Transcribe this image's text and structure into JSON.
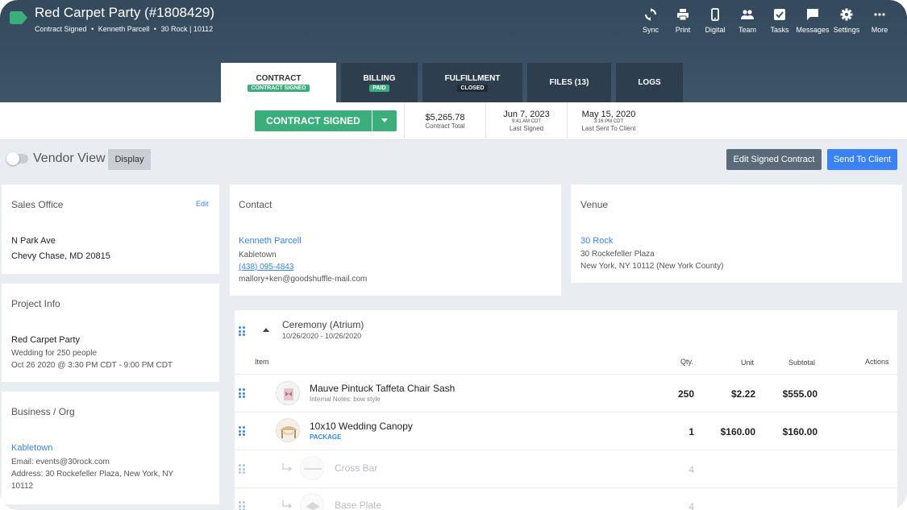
{
  "header": {
    "title": "Red Carpet Party (#1808429)",
    "status": "Contract Signed",
    "client": "Kenneth Parcell",
    "venue_short": "30 Rock | 10112",
    "dot": "•"
  },
  "toolbar": {
    "sync": "Sync",
    "print": "Print",
    "digital": "Digital",
    "team": "Team",
    "tasks": "Tasks",
    "messages": "Messages",
    "settings": "Settings",
    "more": "More"
  },
  "tabs": {
    "contract": {
      "label": "CONTRACT",
      "badge": "CONTRACT SIGNED"
    },
    "billing": {
      "label": "BILLING",
      "badge": "PAID"
    },
    "fulfillment": {
      "label": "FULFILLMENT",
      "badge": "CLOSED"
    },
    "files": {
      "label": "FILES (13)"
    },
    "logs": {
      "label": "LOGS"
    }
  },
  "statusbar": {
    "action_label": "CONTRACT SIGNED",
    "total_value": "$5,265.78",
    "total_label": "Contract Total",
    "signed_date": "Jun 7, 2023",
    "signed_time": "9:41 AM CDT",
    "signed_label": "Last Signed",
    "sent_date": "May 15, 2020",
    "sent_time": "3:16 PM CDT",
    "sent_label": "Last Sent To Client"
  },
  "actions": {
    "vendor_view": "Vendor View",
    "display": "Display",
    "edit_signed": "Edit Signed Contract",
    "send_client": "Send To Client"
  },
  "sales_office": {
    "title": "Sales Office",
    "edit": "Edit",
    "line1": "N Park Ave",
    "line2": "Chevy Chase, MD 20815"
  },
  "contact": {
    "title": "Contact",
    "name": "Kenneth Parcell",
    "company": "Kabletown",
    "phone": "(438) 095-4843",
    "email": "mallory+ken@goodshuffle-mail.com"
  },
  "venue": {
    "title": "Venue",
    "name": "30 Rock",
    "address1": "30 Rockefeller Plaza",
    "address2": "New York, NY 10112 (New York County)"
  },
  "project": {
    "title": "Project Info",
    "name": "Red Carpet Party",
    "desc": "Wedding for 250 people",
    "when": "Oct 26 2020 @ 3:30 PM CDT - 9:00 PM CDT"
  },
  "business": {
    "title": "Business / Org",
    "name": "Kabletown",
    "email": "Email: events@30rock.com",
    "address": "Address: 30 Rockefeller Plaza, New York, NY",
    "zip": "10112"
  },
  "items": {
    "section_title": "Ceremony (Atrium)",
    "section_dates": "10/26/2020 - 10/26/2020",
    "columns": {
      "item": "Item",
      "qty": "Qty.",
      "unit": "Unit",
      "subtotal": "Subtotal",
      "actions": "Actions"
    },
    "rows": [
      {
        "name": "Mauve Pintuck Taffeta Chair Sash",
        "note": "Internal Notes: bow style",
        "qty": "250",
        "unit": "$2.22",
        "subtotal": "$555.00"
      },
      {
        "name": "10x10 Wedding Canopy",
        "note": "PACKAGE",
        "qty": "1",
        "unit": "$160.00",
        "subtotal": "$160.00"
      },
      {
        "name": "Cross Bar",
        "qty": "4"
      },
      {
        "name": "Base Plate",
        "qty": "4"
      }
    ]
  },
  "colors": {
    "accent_green": "#3cae7c",
    "accent_blue": "#3b82f6",
    "header": "#34495c"
  }
}
